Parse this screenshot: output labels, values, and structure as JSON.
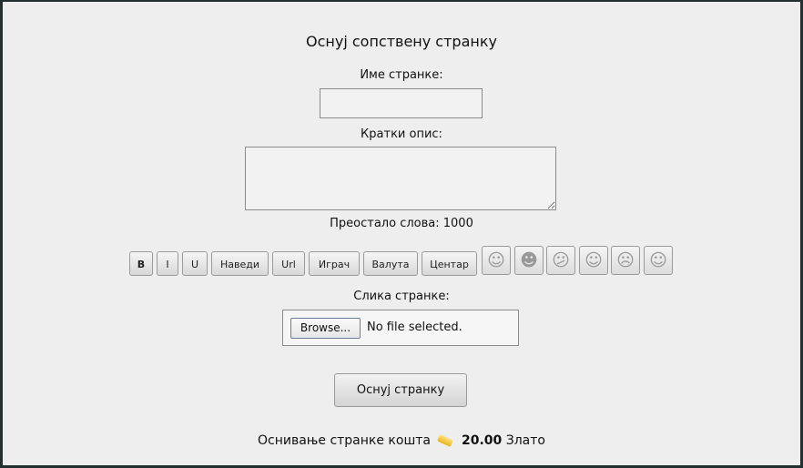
{
  "title": "Оснуј сопствену странку",
  "name_label": "Име странке:",
  "name_value": "",
  "desc_label": "Кратки опис:",
  "desc_value": "",
  "remaining": "Преостало слова: 1000",
  "toolbar": [
    "B",
    "I",
    "U",
    "Наведи",
    "Url",
    "Играч",
    "Валута",
    "Центар"
  ],
  "smileys": [
    "☺",
    "☻",
    "😕",
    "☺",
    "☹",
    "☺"
  ],
  "image_label": "Слика странке:",
  "browse_label": "Browse...",
  "no_file": "No file selected.",
  "submit_label": "Оснуј странку",
  "cost_text": "Оснивање странке кошта",
  "cost_amount": "20.00",
  "cost_currency": "Злато"
}
